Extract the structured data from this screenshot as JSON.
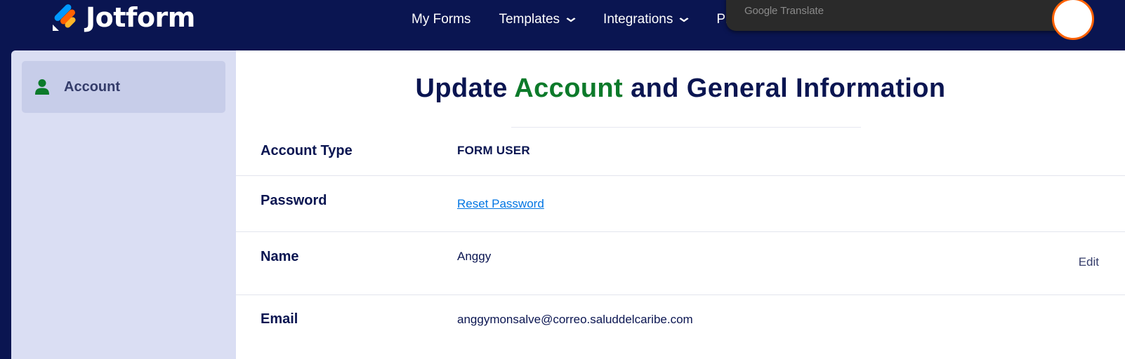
{
  "header": {
    "brand": "Jotform",
    "nav": [
      {
        "label": "My Forms",
        "dropdown": false
      },
      {
        "label": "Templates",
        "dropdown": true
      },
      {
        "label": "Integrations",
        "dropdown": true
      },
      {
        "label": "Pr",
        "dropdown": false
      }
    ],
    "chevron": "⌄",
    "google_translate": {
      "brand": "Google",
      "product": "Translate"
    }
  },
  "sidebar": {
    "items": [
      {
        "label": "Account",
        "icon": "user-icon",
        "active": true
      }
    ]
  },
  "main": {
    "title": {
      "part1": "Update ",
      "accent": "Account",
      "part2": " and General Information"
    },
    "rows": [
      {
        "key": "Account Type",
        "value": "FORM USER"
      },
      {
        "key": "Password",
        "value": "Reset Password"
      },
      {
        "key": "Name",
        "value": "Anggy",
        "action": "Edit"
      },
      {
        "key": "Email",
        "value": "anggymonsalve@correo.saluddelcaribe.com"
      }
    ]
  },
  "colors": {
    "navy": "#0a1551",
    "accent_green": "#0c7a2a",
    "sidebar_bg": "#dadef3",
    "sidebar_active": "#c7cde9",
    "link_blue": "#0075e3",
    "avatar_ring": "#ff6100"
  }
}
